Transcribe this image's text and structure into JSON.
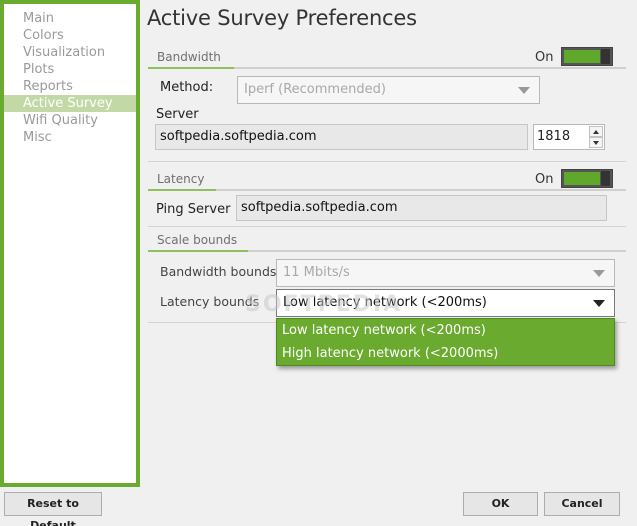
{
  "sidebar": {
    "items": [
      {
        "label": "Main"
      },
      {
        "label": "Colors"
      },
      {
        "label": "Visualization"
      },
      {
        "label": "Plots"
      },
      {
        "label": "Reports"
      },
      {
        "label": "Active Survey",
        "selected": true
      },
      {
        "label": "Wifi Quality"
      },
      {
        "label": "Misc"
      }
    ]
  },
  "page": {
    "title": "Active Survey Preferences"
  },
  "bandwidth": {
    "section_label": "Bandwidth",
    "toggle_label": "On",
    "toggle_on": true,
    "method_label": "Method:",
    "method_value": "Iperf (Recommended)",
    "server_label": "Server",
    "server_value": "softpedia.softpedia.com",
    "port_value": "1818"
  },
  "latency": {
    "section_label": "Latency",
    "toggle_label": "On",
    "toggle_on": true,
    "ping_label": "Ping Server",
    "ping_value": "softpedia.softpedia.com"
  },
  "scale_bounds": {
    "section_label": "Scale bounds",
    "bandwidth_label": "Bandwidth bounds",
    "bandwidth_value": "11 Mbits/s",
    "latency_label": "Latency bounds",
    "latency_value": "Low latency network (<200ms)",
    "latency_options": [
      "Low latency network (<200ms)",
      "High latency network (<2000ms)"
    ]
  },
  "watermark": "SOFTPEDIA",
  "footer": {
    "reset_label": "Reset to Default",
    "ok_label": "OK",
    "cancel_label": "Cancel"
  },
  "colors": {
    "accent": "#6aaa2e",
    "toggle_fill": "#5fa82c",
    "selected_nav": "#c2d9a6"
  }
}
